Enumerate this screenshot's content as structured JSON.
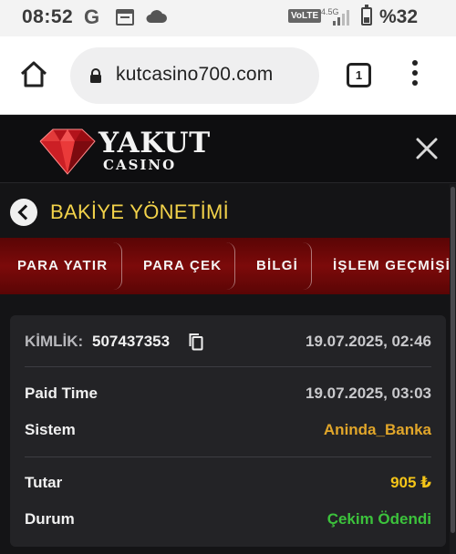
{
  "status_bar": {
    "time": "08:52",
    "google_letter": "G",
    "network_badge": "VoLTE",
    "network_type": "4.5G",
    "battery_percent": "%32",
    "battery_level": 0.32
  },
  "browser": {
    "url": "kutcasino700.com",
    "tab_count": "1"
  },
  "site": {
    "logo_text": "YAKUT",
    "logo_subtext": "CASINO"
  },
  "panel": {
    "title": "BAKİYE YÖNETİMİ"
  },
  "tabs": [
    {
      "label": "PARA YATIR"
    },
    {
      "label": "PARA ÇEK"
    },
    {
      "label": "BİLGİ"
    },
    {
      "label": "İŞLEM GEÇMİŞİ"
    }
  ],
  "transaction": {
    "id_label": "KİMLİK:",
    "id_value": "507437353",
    "created_at": "19.07.2025, 02:46",
    "paid_time_label": "Paid Time",
    "paid_time_value": "19.07.2025, 03:03",
    "system_label": "Sistem",
    "system_value": "Aninda_Banka",
    "amount_label": "Tutar",
    "amount_value": "905 ₺",
    "status_label": "Durum",
    "status_value": "Çekim Ödendi"
  },
  "colors": {
    "accent_yellow": "#f2d24a",
    "system_orange": "#e1a62a",
    "amount_yellow": "#f5c518",
    "status_green": "#3cc23c",
    "tab_red": "#7c0a0a",
    "card_bg": "#232326"
  },
  "icons": {
    "home": "home-icon",
    "lock": "lock-icon",
    "close": "close-icon",
    "back": "chevron-left-icon",
    "copy": "copy-icon",
    "menu": "more-vert-icon"
  }
}
